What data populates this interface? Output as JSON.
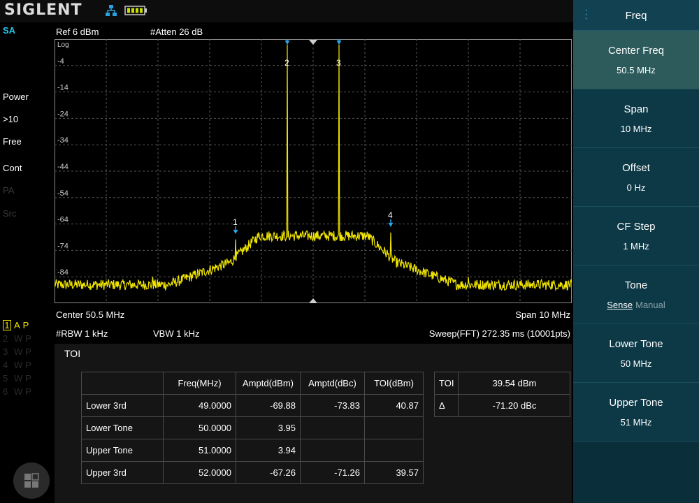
{
  "header": {
    "brand": "SIGLENT"
  },
  "left_status": {
    "mode": "SA",
    "items": [
      {
        "text": "Power",
        "dim": false
      },
      {
        "text": ">10",
        "dim": false
      },
      {
        "text": "Free",
        "dim": false
      },
      {
        "text": "Cont",
        "dim": false
      },
      {
        "text": "PA",
        "dim": true
      },
      {
        "text": "Src",
        "dim": true
      }
    ]
  },
  "measurement": {
    "ref": "Ref  6 dBm",
    "atten": "#Atten  26 dB",
    "center": "Center  50.5 MHz",
    "span": "Span  10 MHz",
    "rbw": "#RBW  1 kHz",
    "vbw": "VBW  1 kHz",
    "sweep": "Sweep(FFT)  272.35 ms (10001pts)"
  },
  "traces": [
    {
      "num": "1",
      "a": "A",
      "p": "P",
      "active": true
    },
    {
      "num": "2",
      "a": "W",
      "p": "P",
      "active": false
    },
    {
      "num": "3",
      "a": "W",
      "p": "P",
      "active": false
    },
    {
      "num": "4",
      "a": "W",
      "p": "P",
      "active": false
    },
    {
      "num": "5",
      "a": "W",
      "p": "P",
      "active": false
    },
    {
      "num": "6",
      "a": "W",
      "p": "P",
      "active": false
    }
  ],
  "chart_data": {
    "type": "line",
    "scale_label": "Log",
    "y_ticks": [
      "-4",
      "-14",
      "-24",
      "-34",
      "-44",
      "-54",
      "-64",
      "-74",
      "-84"
    ],
    "ylim": [
      -94,
      6
    ],
    "xlim": [
      45.5,
      55.5
    ],
    "trace_color": "#f0e500",
    "marker_color": "#2aa6e8",
    "markers": [
      {
        "label": "1",
        "freq": 49.0,
        "level": -69.88
      },
      {
        "label": "2",
        "freq": 50.0,
        "level": 3.95
      },
      {
        "label": "3",
        "freq": 51.0,
        "level": 3.94
      },
      {
        "label": "4",
        "freq": 52.0,
        "level": -67.26
      }
    ]
  },
  "toi": {
    "title": "TOI",
    "columns": [
      "",
      "Freq(MHz)",
      "Amptd(dBm)",
      "Amptd(dBc)",
      "TOI(dBm)"
    ],
    "rows": [
      {
        "label": "Lower 3rd",
        "freq": "49.0000",
        "amptd_dbm": "-69.88",
        "amptd_dbc": "-73.83",
        "toi": "40.87"
      },
      {
        "label": "Lower Tone",
        "freq": "50.0000",
        "amptd_dbm": "3.95",
        "amptd_dbc": "",
        "toi": ""
      },
      {
        "label": "Upper Tone",
        "freq": "51.0000",
        "amptd_dbm": "3.94",
        "amptd_dbc": "",
        "toi": ""
      },
      {
        "label": "Upper 3rd",
        "freq": "52.0000",
        "amptd_dbm": "-67.26",
        "amptd_dbc": "-71.26",
        "toi": "39.57"
      }
    ],
    "summary": [
      {
        "label": "TOI",
        "value": "39.54 dBm"
      },
      {
        "label": "Δ",
        "value": "-71.20 dBc"
      }
    ]
  },
  "menu": {
    "title": "Freq",
    "center_freq": {
      "label": "Center Freq",
      "value": "50.5 MHz"
    },
    "span": {
      "label": "Span",
      "value": "10 MHz"
    },
    "offset": {
      "label": "Offset",
      "value": "0 Hz"
    },
    "cf_step": {
      "label": "CF Step",
      "value": "1 MHz"
    },
    "tone": {
      "label": "Tone",
      "option_on": "Sense",
      "option_off": "Manual"
    },
    "lower_tone": {
      "label": "Lower Tone",
      "value": "50 MHz"
    },
    "upper_tone": {
      "label": "Upper Tone",
      "value": "51 MHz"
    }
  },
  "colors": {
    "accent": "#29c6e8",
    "trace": "#f0e500",
    "menu_bg": "#0a2e3a",
    "menu_selected": "#2d5b5b"
  }
}
